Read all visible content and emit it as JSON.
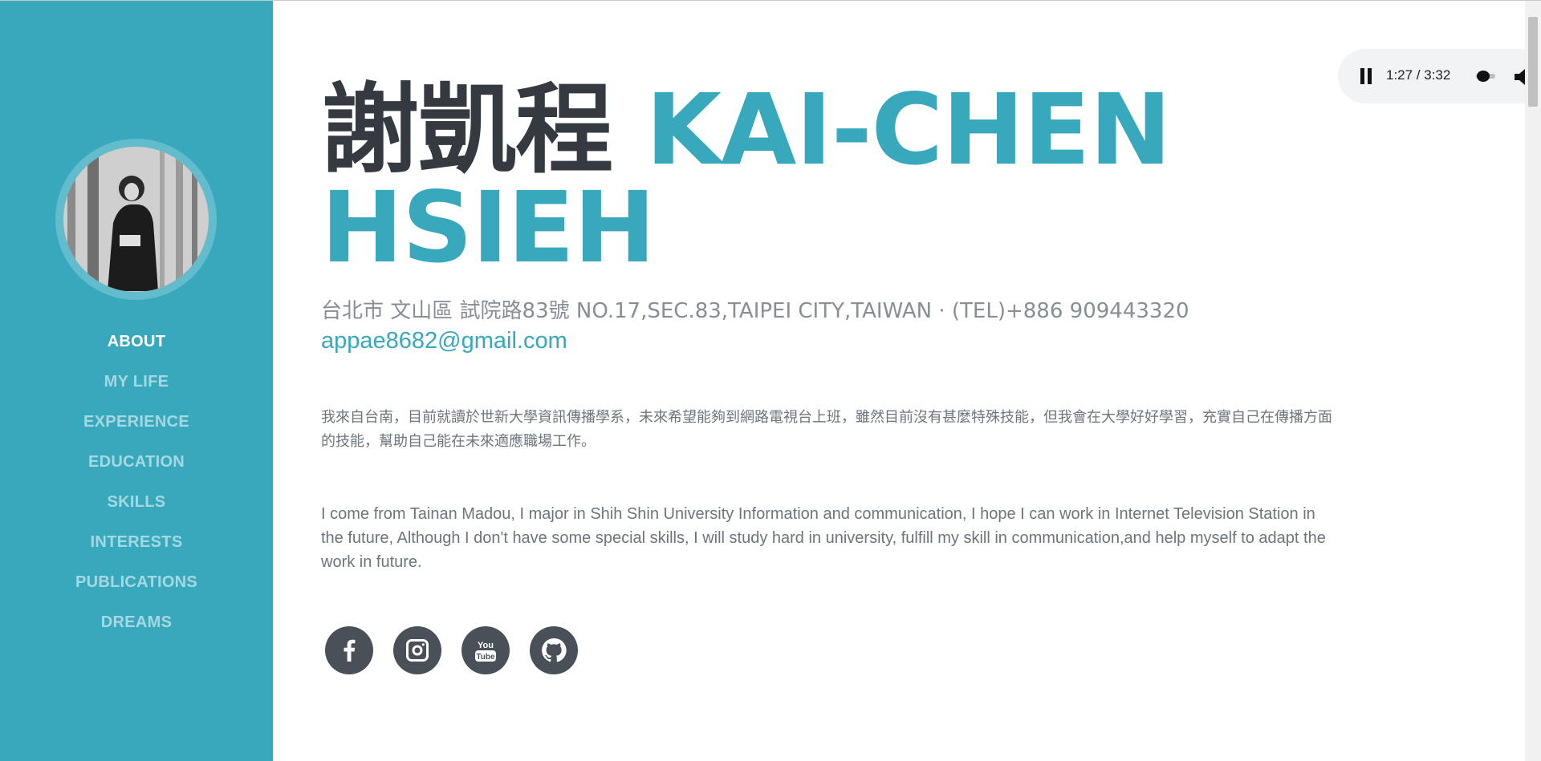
{
  "profile": {
    "name_zh": "謝凱程",
    "name_en_line1": "KAI-CHEN",
    "name_en_line2": "HSIEH",
    "address": "台北市 文山區 試院路83號 NO.17,SEC.83,TAIPEI CITY,TAIWAN · (TEL)+886 909443320",
    "email": "appae8682@gmail.com",
    "about_zh": "我來自台南，目前就讀於世新大學資訊傳播學系，未來希望能夠到網路電視台上班，雖然目前沒有甚麼特殊技能，但我會在大學好好學習，充實自己在傳播方面的技能，幫助自己能在未來適應職場工作。",
    "about_en": "I come from Tainan Madou, I major in Shih Shin University Information and communication, I hope I can work in Internet Television Station in the future, Although I don't have some special skills, I will study hard in university, fulfill my skill in communication,and help myself to adapt the work in future."
  },
  "nav": {
    "items": [
      {
        "label": "ABOUT",
        "active": true
      },
      {
        "label": "MY LIFE"
      },
      {
        "label": "EXPERIENCE"
      },
      {
        "label": "EDUCATION"
      },
      {
        "label": "SKILLS"
      },
      {
        "label": "INTERESTS"
      },
      {
        "label": "PUBLICATIONS"
      },
      {
        "label": "DREAMS"
      }
    ]
  },
  "social": [
    {
      "icon": "facebook-icon"
    },
    {
      "icon": "instagram-icon"
    },
    {
      "icon": "youtube-icon"
    },
    {
      "icon": "github-icon"
    }
  ],
  "player": {
    "time": "1:27 / 3:32",
    "playing": true,
    "progress": 0.41
  },
  "colors": {
    "accent": "#38a8bc",
    "dark": "#343a40",
    "muted": "#868e96",
    "social_bg": "#495057"
  }
}
